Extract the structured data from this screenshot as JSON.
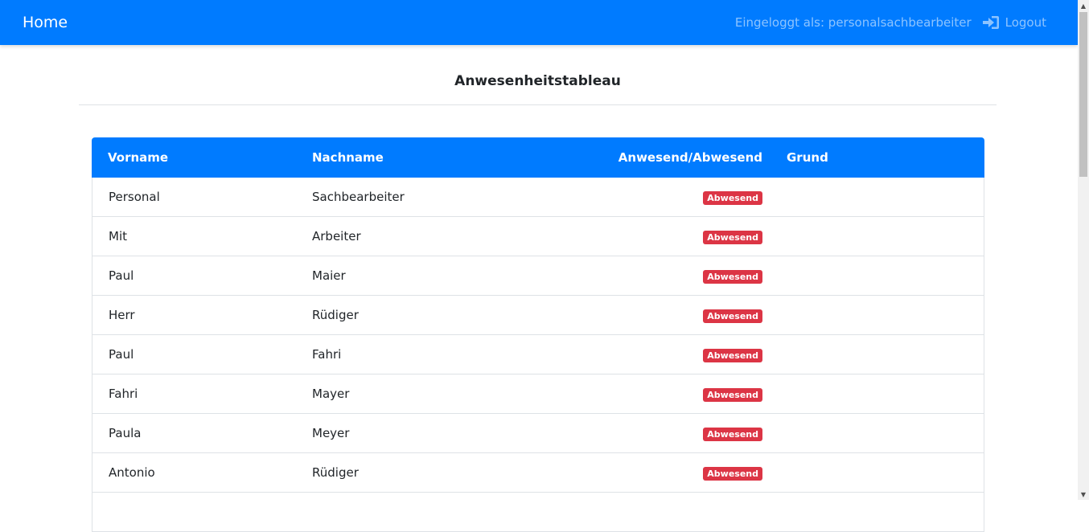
{
  "navbar": {
    "brand": "Home",
    "logged_in_text": "Eingeloggt als: personalsachbearbeiter",
    "logout_label": "Logout",
    "color": "#007bff"
  },
  "page": {
    "title": "Anwesenheitstableau"
  },
  "table": {
    "headers": {
      "vorname": "Vorname",
      "nachname": "Nachname",
      "status": "Anwesend/Abwesend",
      "grund": "Grund"
    },
    "rows": [
      {
        "vorname": "Personal",
        "nachname": "Sachbearbeiter",
        "status": "Abwesend",
        "grund": ""
      },
      {
        "vorname": "Mit",
        "nachname": "Arbeiter",
        "status": "Abwesend",
        "grund": ""
      },
      {
        "vorname": "Paul",
        "nachname": "Maier",
        "status": "Abwesend",
        "grund": ""
      },
      {
        "vorname": "Herr",
        "nachname": "Rüdiger",
        "status": "Abwesend",
        "grund": ""
      },
      {
        "vorname": "Paul",
        "nachname": "Fahri",
        "status": "Abwesend",
        "grund": ""
      },
      {
        "vorname": "Fahri",
        "nachname": "Mayer",
        "status": "Abwesend",
        "grund": ""
      },
      {
        "vorname": "Paula",
        "nachname": "Meyer",
        "status": "Abwesend",
        "grund": ""
      },
      {
        "vorname": "Antonio",
        "nachname": "Rüdiger",
        "status": "Abwesend",
        "grund": ""
      },
      {
        "vorname": "",
        "nachname": "",
        "status": "",
        "grund": ""
      }
    ],
    "status_color": "#dc3545"
  },
  "icons": {
    "logout": "sign-in-icon"
  }
}
